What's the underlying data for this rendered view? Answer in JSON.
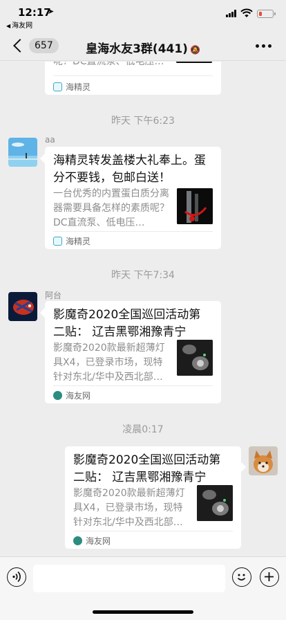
{
  "status_bar": {
    "time": "12:17",
    "back_app": "海友网"
  },
  "nav": {
    "back_count": "657",
    "title": "皇海水友3群(441)"
  },
  "messages": [
    {
      "kind": "card_partial",
      "desc_tail": "呢？DC直流泵、低电压…",
      "source": "海精灵"
    },
    {
      "kind": "timestamp",
      "text": "昨天 下午6:23"
    },
    {
      "kind": "card",
      "sender": "aa",
      "title": "海精灵转发盖楼大礼奉上。蛋分不要钱，包邮白送！",
      "desc": "一台优秀的内置蛋白质分离器需要具备怎样的素质呢？DC直流泵、低电压…",
      "source": "海精灵"
    },
    {
      "kind": "timestamp",
      "text": "昨天 下午7:34"
    },
    {
      "kind": "card",
      "sender": "阿台",
      "title": "影魔奇2020全国巡回活动第二贴： 辽吉黑鄂湘豫青宁",
      "desc": "影魔奇2020款最新超薄灯具X4，已登录市场，现特针对东北/华中及西北部…",
      "source": "海友网"
    },
    {
      "kind": "timestamp",
      "text": "凌晨0:17"
    },
    {
      "kind": "card_self",
      "title": "影魔奇2020全国巡回活动第二贴： 辽吉黑鄂湘豫青宁",
      "desc": "影魔奇2020款最新超薄灯具X4，已登录市场，现特针对东北/华中及西北部…",
      "source": "海友网"
    }
  ],
  "input": {
    "value": ""
  }
}
